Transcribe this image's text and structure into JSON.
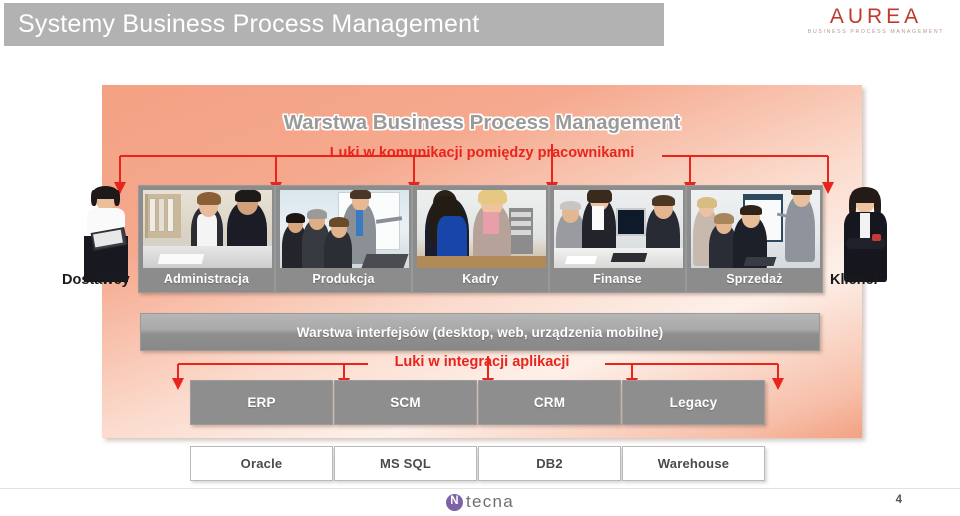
{
  "header": {
    "title": "Systemy Business Process Management",
    "logo": {
      "brand": "AUREA",
      "tagline": "BUSINESS PROCESS MANAGEMENT",
      "brand_color": "#c0392b"
    }
  },
  "diagram": {
    "bpm_layer_heading": "Warstwa Business Process Management",
    "gap_communication_label": "Luki w komunikacji pomiędzy pracownikami",
    "gap_integration_label": "Luki w integracji aplikacji",
    "interface_layer_label": "Warstwa interfejsów (desktop, web, urządzenia mobilne)",
    "gap_color": "#e8241c",
    "panel_color": "#f4a183",
    "departments": [
      {
        "label": "Administracja"
      },
      {
        "label": "Produkcja"
      },
      {
        "label": "Kadry"
      },
      {
        "label": "Finanse"
      },
      {
        "label": "Sprzedaż"
      }
    ],
    "external_left": {
      "label": "Dostawcy"
    },
    "external_right": {
      "label": "Klienci"
    },
    "applications": [
      {
        "label": "ERP"
      },
      {
        "label": "SCM"
      },
      {
        "label": "CRM"
      },
      {
        "label": "Legacy"
      }
    ],
    "databases": [
      {
        "label": "Oracle"
      },
      {
        "label": "MS SQL"
      },
      {
        "label": "DB2"
      },
      {
        "label": "Warehouse"
      }
    ]
  },
  "footer": {
    "logo_mark": "N",
    "logo_text": "tecna",
    "page_number": "4"
  }
}
